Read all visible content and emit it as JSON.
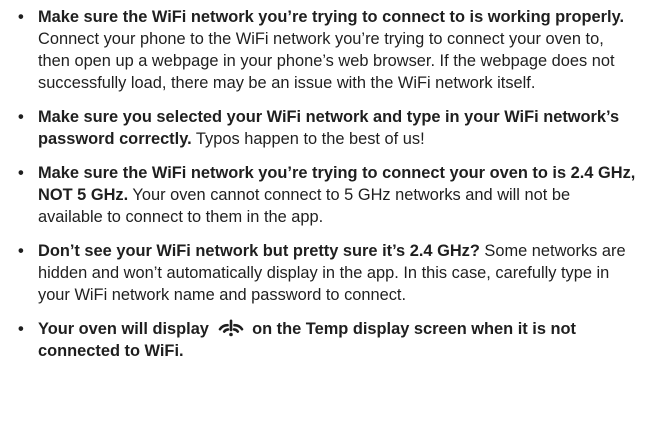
{
  "tips": [
    {
      "bold": "Make sure the WiFi network you’re trying to connect to is working properly.",
      "text": " Connect your phone to the WiFi network you’re trying to connect your oven to, then open up a webpage in your phone’s web browser. If the webpage does not successfully load, there may be an issue with the WiFi network itself."
    },
    {
      "bold": "Make sure you selected your WiFi network and type in your WiFi network’s password correctly.",
      "text": " Typos happen to the best of us!"
    },
    {
      "bold": "Make sure the WiFi network you’re trying to connect your oven to is 2.4 GHz, NOT 5 GHz.",
      "text": " Your oven cannot connect to 5 GHz networks and will not be available to connect to them in the app."
    },
    {
      "bold": "Don’t see your WiFi network but pretty sure it’s 2.4 GHz?",
      "text": " Some networks are hidden and won’t automatically display in the app. In this case, carefully type in your WiFi network name and password to connect."
    },
    {
      "bold_before_icon": "Your oven will display",
      "icon": "wifi-off-icon",
      "bold_after_icon": "on the Temp display screen when it is not connected to WiFi."
    }
  ]
}
